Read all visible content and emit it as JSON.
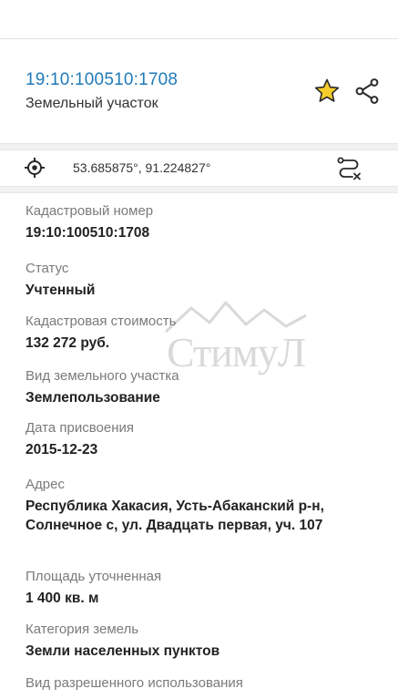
{
  "header": {
    "cadastral_link": "19:10:100510:1708",
    "object_type": "Земельный участок"
  },
  "coords": {
    "text": "53.685875°, 91.224827°"
  },
  "properties": {
    "cad_number": {
      "label": "Кадастровый номер",
      "value": "19:10:100510:1708"
    },
    "status": {
      "label": "Статус",
      "value": "Учтенный"
    },
    "cost": {
      "label": "Кадастровая стоимость",
      "value": "132 272 руб."
    },
    "land_kind": {
      "label": "Вид земельного участка",
      "value": "Землепользование"
    },
    "assign_date": {
      "label": "Дата присвоения",
      "value": "2015-12-23"
    },
    "address": {
      "label": "Адрес",
      "value": "Республика Хакасия, Усть-Абаканский р-н, Солнечное с, ул. Двадцать первая, уч. 107"
    },
    "area": {
      "label": "Площадь уточненная",
      "value": "1 400 кв. м"
    },
    "land_category": {
      "label": "Категория земель",
      "value": "Земли населенных пунктов"
    },
    "permitted_use": {
      "label": "Вид разрешенного использования"
    }
  },
  "watermark": {
    "text": "СтимуЛ"
  },
  "colors": {
    "link": "#1f7ab8",
    "star": "#f2c21b",
    "label": "#7a7a7a",
    "value": "#222222"
  },
  "icons": {
    "favorite": "star-icon",
    "share": "share-icon",
    "locate": "crosshair-icon",
    "route": "route-icon"
  }
}
